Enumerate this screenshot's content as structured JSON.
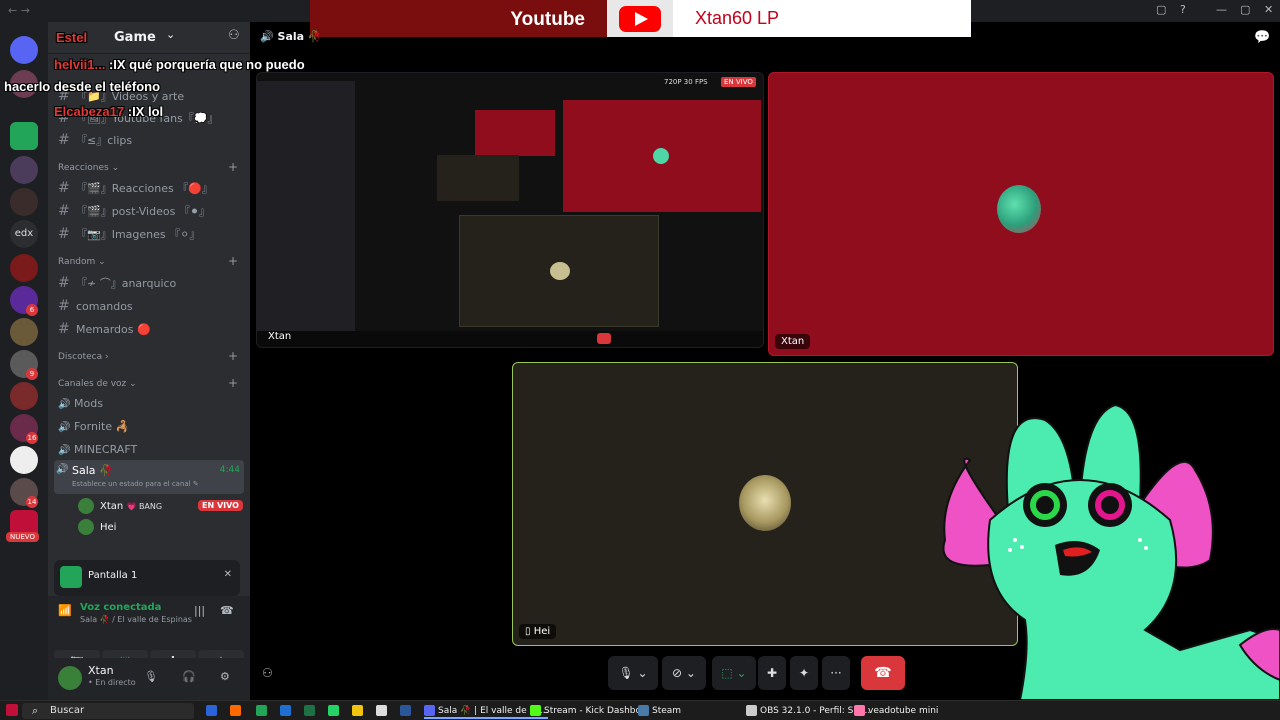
{
  "window": {
    "nav_arrows": "← →",
    "controls": [
      "▢",
      "?",
      "—",
      "▢",
      "✕"
    ]
  },
  "youtube_banner": {
    "label": "Youtube",
    "channel": "Xtan60 LP"
  },
  "rail": {
    "text_badge": "edx",
    "badges": [
      "6",
      "9",
      "16",
      "14"
    ],
    "new_label": "NUEVO"
  },
  "server": {
    "name": "Game"
  },
  "chat_overlay": [
    {
      "user": "Estel",
      "text": "",
      "user_color": "#e03a3a"
    },
    {
      "user": "helvii1...",
      "text": ":IX qué porquería que no puedo",
      "user_color": "#e03a3a"
    },
    {
      "user": "",
      "text": "hacerlo desde el teléfono",
      "user_color": "#ffffff"
    },
    {
      "user": "Elcabeza17",
      "text": ":IX lol",
      "user_color": "#e03a3a"
    }
  ],
  "channels_top": [
    {
      "label": "『📁』Videos y arte"
    },
    {
      "label": "『🖼』Youtube fans『💭』"
    },
    {
      "label": "『≤』clips"
    }
  ],
  "categories": {
    "reacciones": "Reacciones",
    "random": "Random",
    "discoteca": "Discoteca",
    "voz": "Canales de voz"
  },
  "reacciones_channels": [
    {
      "label": "『🎬』Reacciones 『🔴』"
    },
    {
      "label": "『🎬』post-Videos 『⚫』"
    },
    {
      "label": "『📷』Imagenes 『⚪』"
    }
  ],
  "random_channels": [
    {
      "label": "『≁ ⌒』anarquico"
    },
    {
      "label": "comandos"
    },
    {
      "label": "Memardos 🔴"
    }
  ],
  "voice_channels": [
    {
      "label": "Mods"
    },
    {
      "label": "Fornite 🦂"
    },
    {
      "label": "MINECRAFT"
    }
  ],
  "active_voice": {
    "name": "Sala 🥀",
    "time": "4:44",
    "status_placeholder": "Establece un estado para el canal ✎",
    "users": [
      {
        "name": "Xtan",
        "tag": "💗 BANG",
        "live": "EN VIVO"
      },
      {
        "name": "Hei"
      }
    ]
  },
  "share_popup": {
    "label": "Pantalla 1"
  },
  "voice_connection": {
    "status": "Voz conectada",
    "location": "Sala 🥀 / El valle de Espinas"
  },
  "user_panel": {
    "name": "Xtan",
    "status": "• En directo"
  },
  "main": {
    "channel_title": "Sala 🥀",
    "share_badge_quality": "720P 30 FPS",
    "share_badge_live": "EN VIVO",
    "share_user_label": "Xtan",
    "xtan_tile_label": "Xtan",
    "hei_tile_label": "Hei"
  },
  "taskbar": {
    "search_placeholder": "Buscar",
    "apps": [
      {
        "label": "Sala 🥀 | El valle de Es...",
        "icon_color": "#5865f2"
      },
      {
        "label": "Stream - Kick Dashbo...",
        "icon_color": "#53fc18"
      },
      {
        "label": "Steam",
        "icon_color": "#1b2838"
      },
      {
        "label": "OBS 32.1.0 - Perfil: Sin...",
        "icon_color": "#cccccc"
      },
      {
        "label": "veadotube mini",
        "icon_color": "#ff77aa"
      }
    ]
  },
  "colors": {
    "accent_live": "#da373c",
    "voice_green": "#23a559",
    "xtan_bg": "#900d1d",
    "hei_bg": "#24221a",
    "avatar_body": "#4cebb0",
    "avatar_ears": "#ef52c5"
  }
}
